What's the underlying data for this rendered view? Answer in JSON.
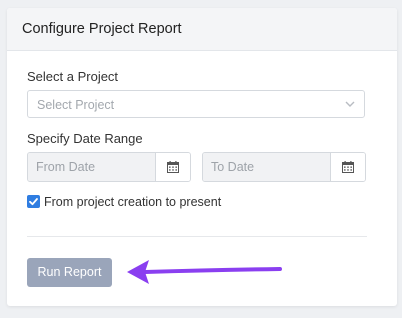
{
  "card": {
    "title": "Configure Project Report"
  },
  "form": {
    "project_label": "Select a Project",
    "project_placeholder": "Select Project",
    "date_label": "Specify Date Range",
    "from_placeholder": "From Date",
    "to_placeholder": "To Date",
    "checkbox_label": "From project creation to present",
    "checkbox_checked": true,
    "run_button": "Run Report"
  },
  "colors": {
    "accent": "#2f7de1",
    "button": "#9aa5ba",
    "arrow": "#8a3ff0"
  },
  "icons": {
    "dropdown": "chevron-down-icon",
    "calendar": "calendar-icon",
    "check": "check-icon",
    "annotation": "arrow-left-icon"
  }
}
